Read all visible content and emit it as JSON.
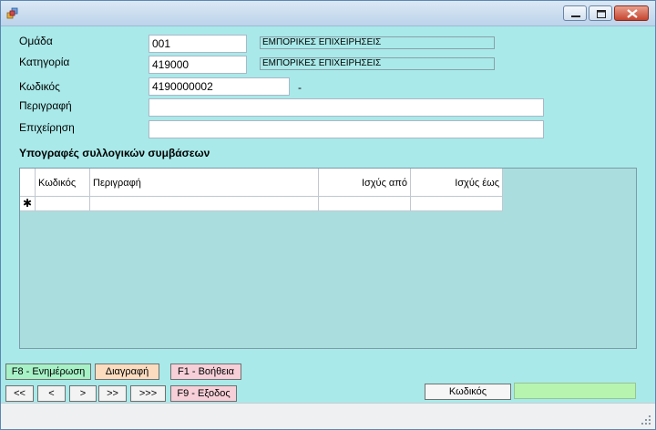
{
  "window": {
    "controls": {
      "minimize_icon": "minimize-icon",
      "maximize_icon": "maximize-icon",
      "close_icon": "close-icon"
    }
  },
  "form": {
    "group_label": "Ομάδα",
    "group_value": "001",
    "group_desc": "ΕΜΠΟΡΙΚΕΣ ΕΠΙΧΕΙΡΗΣΕΙΣ",
    "category_label": "Κατηγορία",
    "category_value": "419000",
    "category_desc": "ΕΜΠΟΡΙΚΕΣ ΕΠΙΧΕΙΡΗΣΕΙΣ",
    "code_label": "Κωδικός",
    "code_value": "4190000002",
    "code_suffix": "-",
    "description_label": "Περιγραφή",
    "description_value": "",
    "business_label": "Επιχείρηση",
    "business_value": ""
  },
  "section": {
    "title": "Υπογραφές συλλογικών συμβάσεων"
  },
  "grid": {
    "columns": [
      "Κωδικός",
      "Περιγραφή",
      "Ισχύς από",
      "Ισχύς έως"
    ],
    "new_row_marker": "✱"
  },
  "buttons": {
    "update": "F8 - Ενημέρωση",
    "delete": "Διαγραφή",
    "help": "F1 - Βοήθεια",
    "first": "<<",
    "prev": "<",
    "next": ">",
    "next_page": ">>",
    "last": ">>>",
    "exit": "F9 - Εξοδος",
    "code": "Κωδικός"
  },
  "colors": {
    "form_bg": "#a9e9e9",
    "update_btn": "#a6f2c6",
    "delete_btn": "#fbdcbf",
    "exit_btn": "#f6cfd8"
  }
}
